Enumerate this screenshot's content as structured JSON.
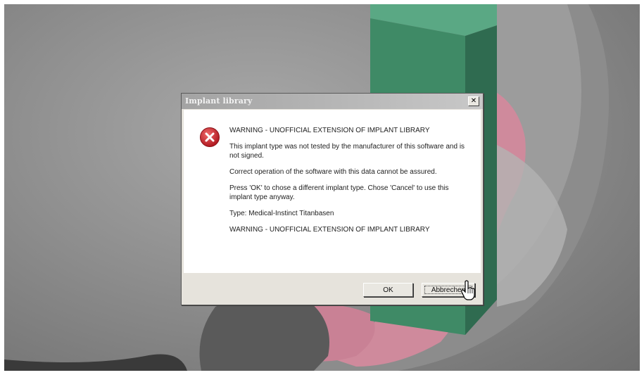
{
  "dialog": {
    "title": "Implant library",
    "close_label": "✕",
    "icon": "error-icon",
    "messages": [
      "WARNING - UNOFFICIAL EXTENSION OF IMPLANT LIBRARY",
      "This implant type was not tested by the manufacturer of this software and is not signed.",
      "Correct operation of the software with this data cannot be assured.",
      "Press 'OK' to chose a different implant type. Chose 'Cancel' to use this implant type anyway.",
      "Type: Medical-Instinct Titanbasen",
      "WARNING - UNOFFICIAL EXTENSION OF IMPLANT LIBRARY"
    ],
    "buttons": {
      "ok_label": "OK",
      "cancel_label": "Abbrechen"
    }
  },
  "colors": {
    "model_green": "#3f8a66",
    "gum_pink": "#cf8a9c",
    "error_red": "#c8202a"
  }
}
